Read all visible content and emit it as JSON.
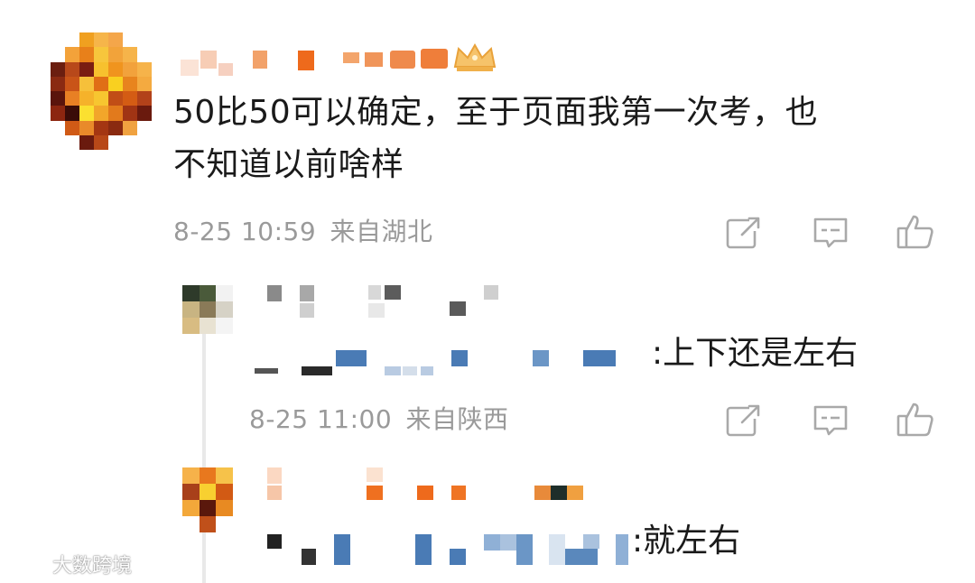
{
  "comments": [
    {
      "username": "▇▇▇",
      "text_line1": "50比50可以确定，至于页面我第一次考，也",
      "text_line2": "不知道以前啥样",
      "date": "8-25 10:59",
      "location": "来自湖北"
    },
    {
      "username": "▇▇▇",
      "reply_text": ":上下还是左右",
      "date": "8-25 11:00",
      "location": "来自陕西"
    },
    {
      "username": "▇▇▇",
      "reply_text": ":就左右"
    }
  ],
  "icons": {
    "forward": "share-icon",
    "comment": "comment-icon",
    "like": "like-icon"
  },
  "watermark": {
    "text": "大数跨境"
  },
  "colors": {
    "text": "#1a1a1a",
    "meta": "#9a9a9a",
    "icon": "#a9a9a9",
    "blur_blue": "#4a7bb5",
    "blur_orange": "#e8601a"
  }
}
